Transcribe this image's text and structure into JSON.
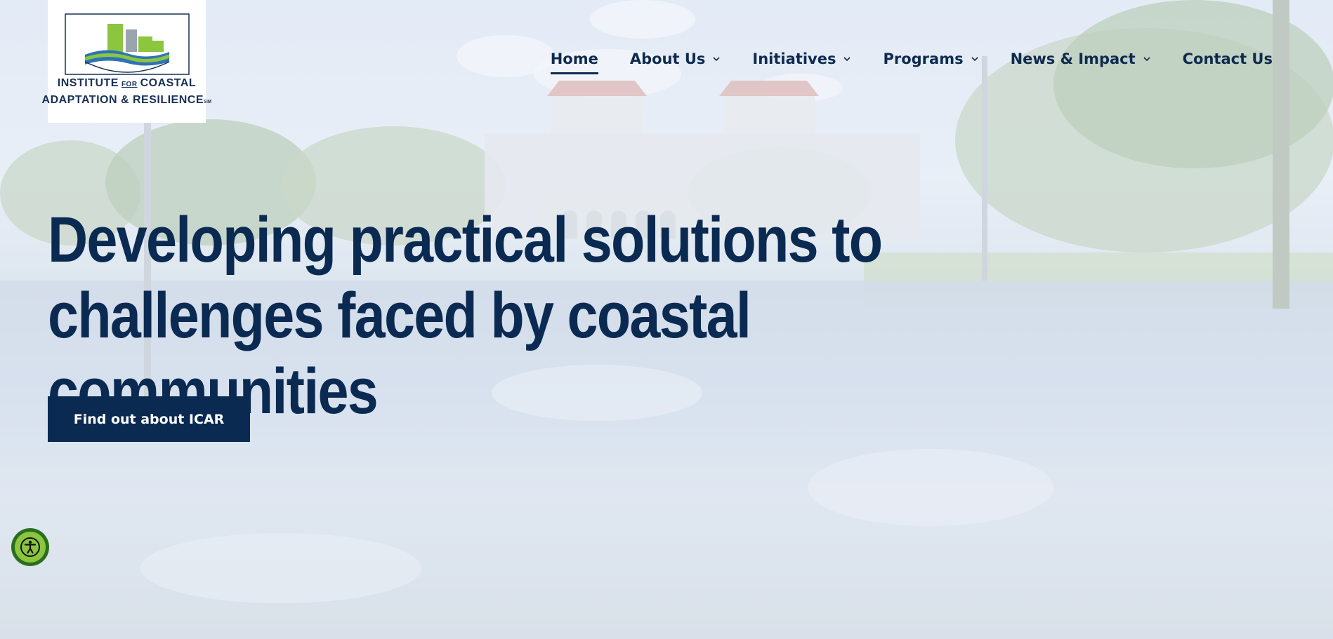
{
  "logo": {
    "line1_a": "INSTITUTE",
    "line1_for": "FOR",
    "line1_b": "COASTAL",
    "line2": "ADAPTATION & RESILIENCE",
    "line2_mark": "SM"
  },
  "nav": {
    "items": [
      {
        "label": "Home",
        "active": true,
        "has_dropdown": false
      },
      {
        "label": "About Us",
        "active": false,
        "has_dropdown": true
      },
      {
        "label": "Initiatives",
        "active": false,
        "has_dropdown": true
      },
      {
        "label": "Programs",
        "active": false,
        "has_dropdown": true
      },
      {
        "label": "News & Impact",
        "active": false,
        "has_dropdown": true
      },
      {
        "label": "Contact Us",
        "active": false,
        "has_dropdown": false
      }
    ]
  },
  "hero": {
    "headline_line1": "Developing practical solutions to",
    "headline_line2": "challenges faced by coastal communities",
    "cta_label": "Find out about ICAR"
  },
  "colors": {
    "brand_navy": "#0b2a52",
    "accessibility_green": "#8cc63f"
  },
  "icons": {
    "accessibility": "accessibility-icon",
    "dropdown": "chevron-down-icon"
  }
}
